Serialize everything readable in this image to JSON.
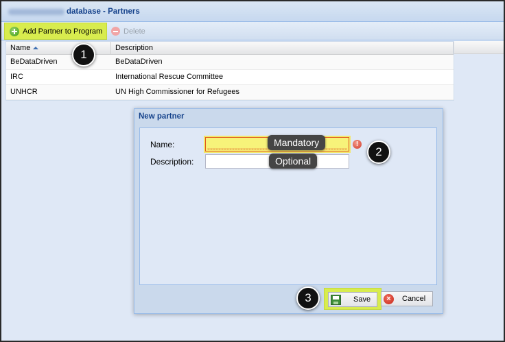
{
  "window": {
    "title": "database - Partners"
  },
  "toolbar": {
    "add_label": "Add Partner to Program",
    "delete_label": "Delete"
  },
  "grid": {
    "columns": [
      "Name",
      "Description"
    ],
    "rows": [
      {
        "name": "BeDataDriven",
        "description": "BeDataDriven"
      },
      {
        "name": "IRC",
        "description": "International Rescue Committee"
      },
      {
        "name": "UNHCR",
        "description": "UN High Commissioner for Refugees"
      }
    ]
  },
  "dialog": {
    "title": "New partner",
    "name_label": "Name:",
    "description_label": "Description:",
    "name_value": "",
    "description_value": "",
    "save_label": "Save",
    "cancel_label": "Cancel"
  },
  "annotations": {
    "callout_1": "1",
    "callout_2": "2",
    "callout_3": "3",
    "tip_mandatory": "Mandatory",
    "tip_optional": "Optional"
  },
  "colors": {
    "highlight": "#d8ec4e",
    "title_text": "#15428b",
    "invalid_field": "#f7f37a"
  },
  "icons": {
    "add": "add-circle-icon",
    "delete": "remove-circle-icon",
    "sort": "sort-ascending-icon",
    "error": "exclamation-icon",
    "save": "floppy-disk-icon",
    "cancel": "cancel-x-icon"
  }
}
